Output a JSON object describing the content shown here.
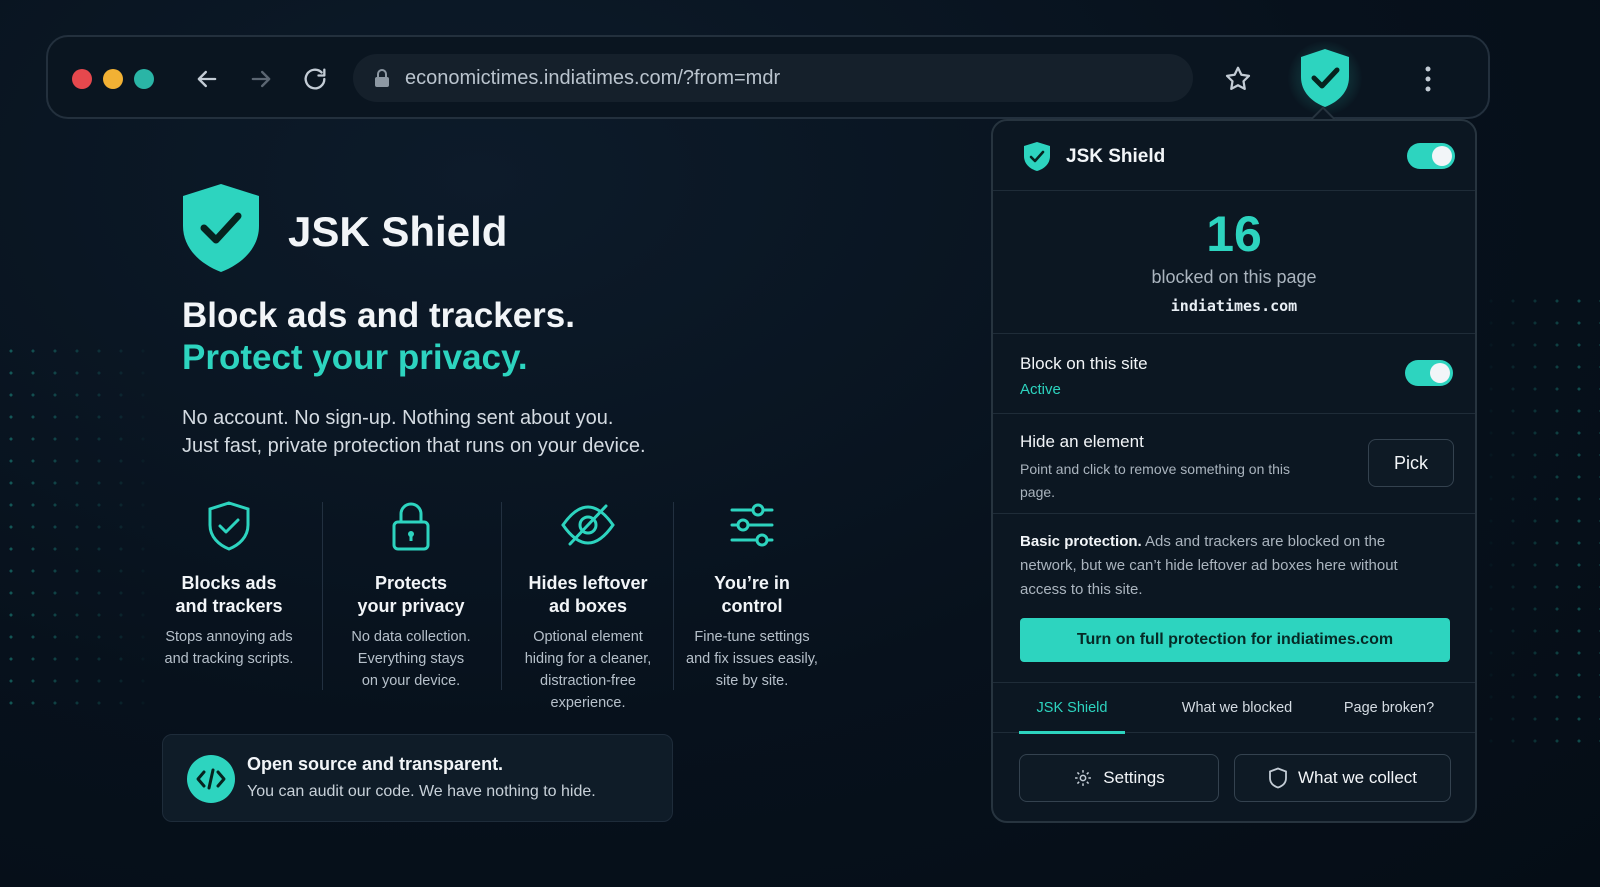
{
  "colors": {
    "accent": "#2dd4bf",
    "background": "#07111c",
    "panel": "#0c1722"
  },
  "browser": {
    "url": "economictimes.indiatimes.com/?from=mdr",
    "icons": [
      "back-arrow-icon",
      "forward-arrow-icon",
      "reload-icon",
      "lock-icon",
      "star-icon",
      "shield-check-icon",
      "kebab-menu-icon"
    ]
  },
  "hero": {
    "brand": "JSK Shield",
    "headline": "Block ads and trackers.",
    "headline_accent": "Protect your privacy.",
    "subtext_line1": "No account. No sign-up. Nothing sent about you.",
    "subtext_line2": "Just fast, private protection that runs on your device."
  },
  "features": [
    {
      "icon": "shield-check-icon",
      "title_l1": "Blocks ads",
      "title_l2": "and trackers",
      "desc": [
        "Stops annoying ads",
        "and tracking scripts."
      ]
    },
    {
      "icon": "lock-icon",
      "title_l1": "Protects",
      "title_l2": "your privacy",
      "desc": [
        "No data collection.",
        "Everything stays",
        "on your device."
      ]
    },
    {
      "icon": "eye-slash-icon",
      "title_l1": "Hides leftover",
      "title_l2": "ad boxes",
      "desc": [
        "Optional element",
        "hiding for a cleaner,",
        "distraction-free",
        "experience."
      ]
    },
    {
      "icon": "sliders-icon",
      "title_l1": "You’re in",
      "title_l2": "control",
      "desc": [
        "Fine-tune settings",
        "and fix issues easily,",
        "site by site."
      ]
    }
  ],
  "oss": {
    "title": "Open source and transparent.",
    "desc": "You can audit our code. We have nothing to hide."
  },
  "popup": {
    "title": "JSK Shield",
    "enabled": true,
    "blocked_count": "16",
    "blocked_label": "blocked on this page",
    "domain": "indiatimes.com",
    "block_site": {
      "title": "Block on this site",
      "status": "Active",
      "enabled": true
    },
    "hide_element": {
      "title": "Hide an element",
      "desc": "Point and click to remove something on this page.",
      "button": "Pick"
    },
    "basic": {
      "bold": "Basic protection.",
      "text": "Ads and trackers are blocked on the network, but we can’t hide leftover ad boxes here without access to this site."
    },
    "cta": "Turn on full protection for indiatimes.com",
    "tabs": [
      "JSK Shield",
      "What we blocked",
      "Page broken?"
    ],
    "active_tab": 0,
    "settings_button": "Settings",
    "collect_button": "What we collect"
  }
}
